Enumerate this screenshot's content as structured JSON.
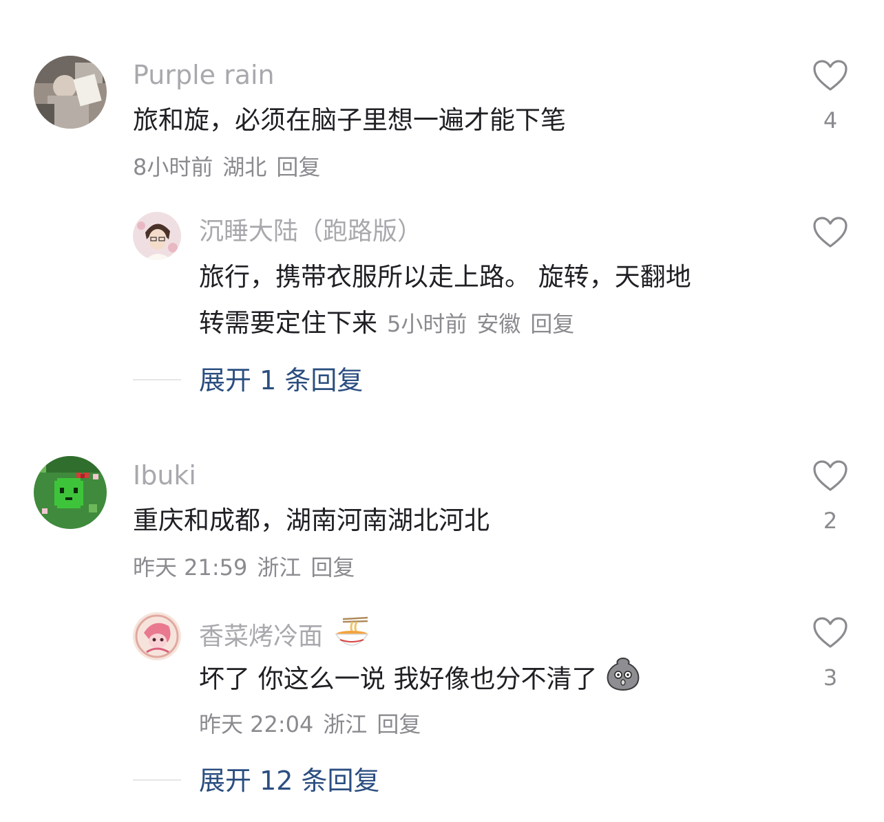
{
  "comments": [
    {
      "username": "Purple rain",
      "content": "旅和旋，必须在脑子里想一遍才能下笔",
      "time": "8小时前",
      "location": "湖北",
      "reply_label": "回复",
      "likes": "4",
      "reply": {
        "username": "沉睡大陆（跑路版）",
        "content_line1": "旅行，携带衣服所以走上路。 旋转，天翻地",
        "content_line2": "转需要定住下来",
        "time": "5小时前",
        "location": "安徽",
        "reply_label": "回复",
        "likes": ""
      },
      "expand_label": "展开 1 条回复"
    },
    {
      "username": "Ibuki",
      "content": "重庆和成都，湖南河南湖北河北",
      "time": "昨天 21:59",
      "location": "浙江",
      "reply_label": "回复",
      "likes": "2",
      "reply": {
        "username": "香菜烤冷面",
        "username_emoji": "noodle-bowl-icon",
        "content": "坏了 你这么一说 我好像也分不清了",
        "content_emoji": "shocked-blob-icon",
        "time": "昨天 22:04",
        "location": "浙江",
        "reply_label": "回复",
        "likes": "3"
      },
      "expand_label": "展开 12 条回复"
    }
  ]
}
